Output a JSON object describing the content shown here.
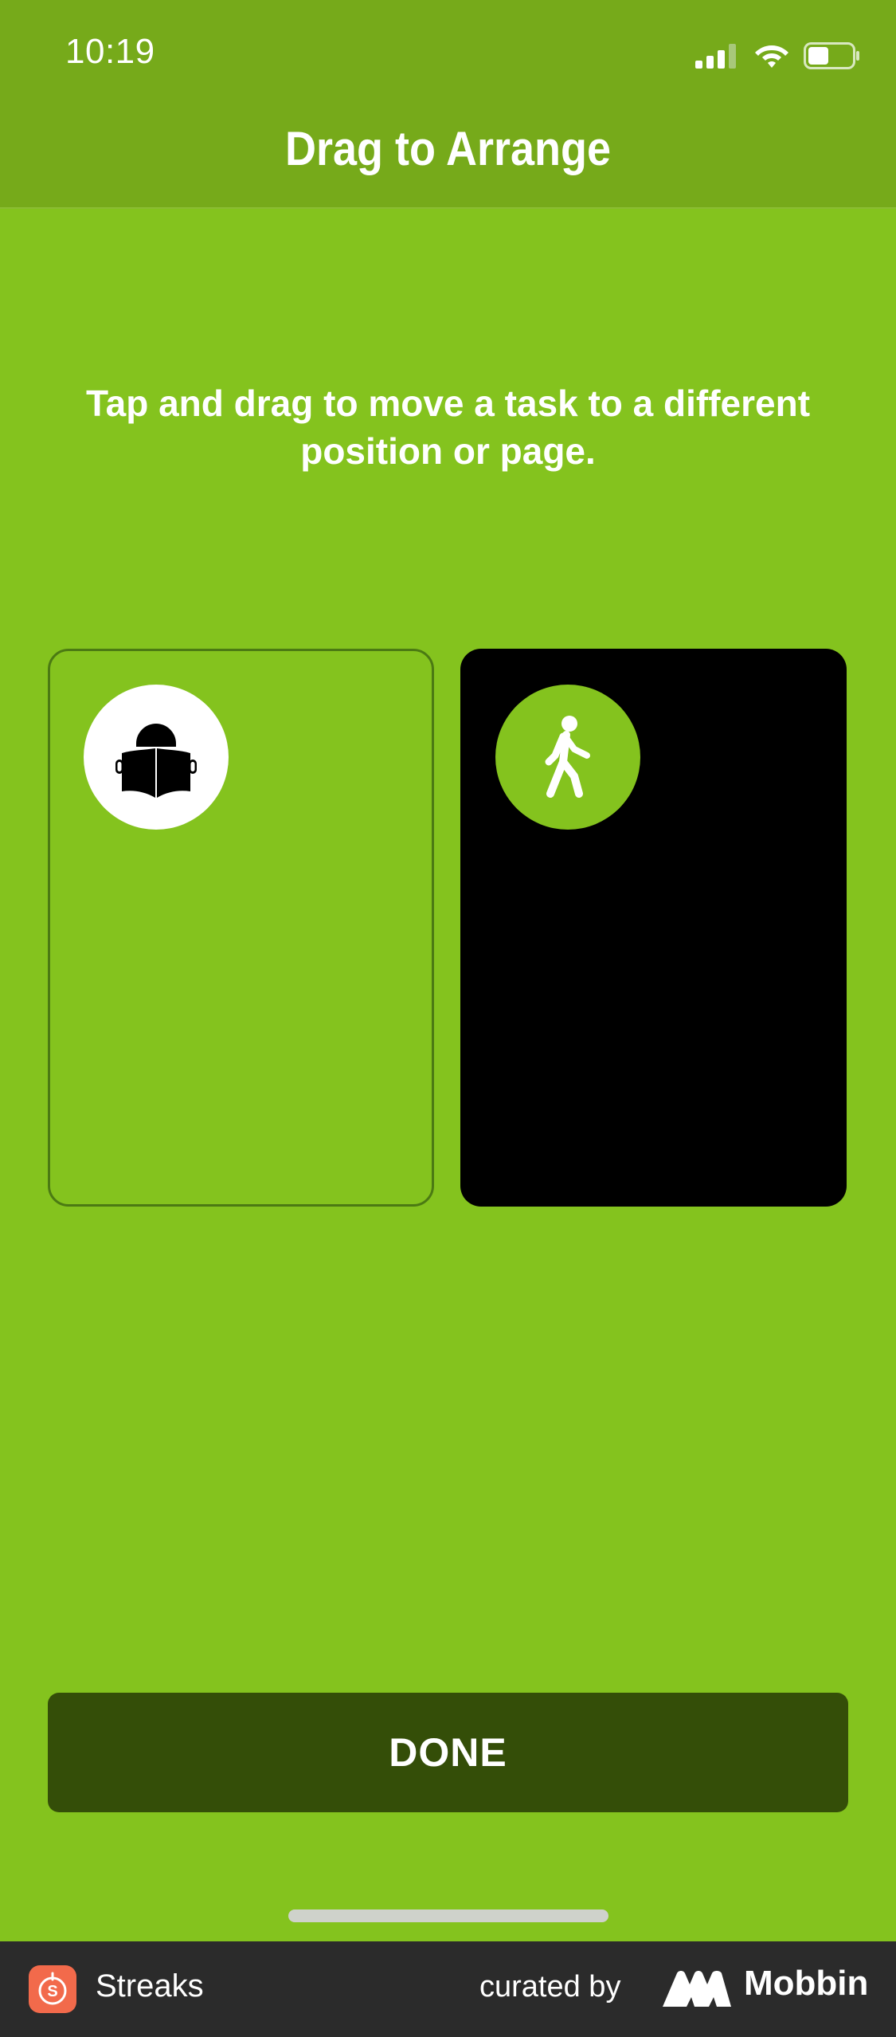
{
  "status_bar": {
    "time": "10:19",
    "icons": [
      "cellular-signal-icon",
      "wifi-icon",
      "battery-icon"
    ]
  },
  "header": {
    "title": "Drag to Arrange"
  },
  "instructions": {
    "text": "Tap and drag to move a task to a different position or page."
  },
  "tasks": [
    {
      "icon": "reading-icon",
      "selected": false
    },
    {
      "icon": "walking-icon",
      "selected": true
    }
  ],
  "actions": {
    "done_label": "DONE"
  },
  "footer": {
    "app_name": "Streaks",
    "curated_label": "curated by",
    "brand": "Mobbin"
  },
  "colors": {
    "background": "#84c31e",
    "header": "#76aa1a",
    "button": "#344e08",
    "selected_card": "#000000"
  }
}
